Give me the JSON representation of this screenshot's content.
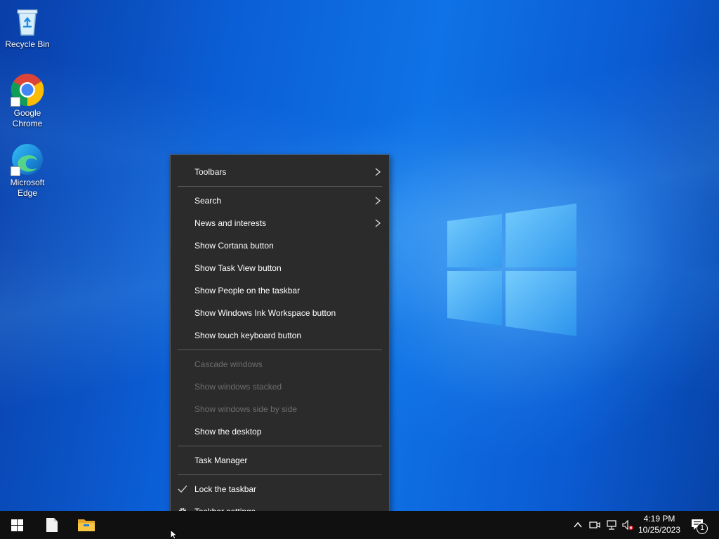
{
  "desktop": {
    "icons": [
      {
        "label": "Recycle Bin"
      },
      {
        "label": "Google Chrome"
      },
      {
        "label": "Microsoft Edge"
      }
    ]
  },
  "context_menu": {
    "items": [
      {
        "label": "Toolbars",
        "submenu": true
      },
      {
        "label": "Search",
        "submenu": true
      },
      {
        "label": "News and interests",
        "submenu": true
      },
      {
        "label": "Show Cortana button"
      },
      {
        "label": "Show Task View button"
      },
      {
        "label": "Show People on the taskbar"
      },
      {
        "label": "Show Windows Ink Workspace button"
      },
      {
        "label": "Show touch keyboard button"
      },
      {
        "label": "Cascade windows",
        "disabled": true
      },
      {
        "label": "Show windows stacked",
        "disabled": true
      },
      {
        "label": "Show windows side by side",
        "disabled": true
      },
      {
        "label": "Show the desktop"
      },
      {
        "label": "Task Manager"
      },
      {
        "label": "Lock the taskbar",
        "checked": true
      },
      {
        "label": "Taskbar settings",
        "icon": "gear-icon"
      }
    ]
  },
  "taskbar": {
    "pinned": [
      {
        "icon": "windows-start-icon"
      },
      {
        "icon": "file-icon"
      },
      {
        "icon": "file-explorer-icon"
      }
    ],
    "tray": {
      "icons": [
        "chevron-up-icon",
        "camera-icon",
        "network-icon",
        "volume-muted-icon"
      ],
      "notification_count": "1"
    },
    "clock": {
      "time": "4:19 PM",
      "date": "10/25/2023"
    }
  },
  "colors": {
    "menu_bg": "#2b2b2b",
    "menu_disabled_text": "#6d6d6d",
    "taskbar_bg": "#101010",
    "desktop_blue": "#0b5fd6"
  }
}
